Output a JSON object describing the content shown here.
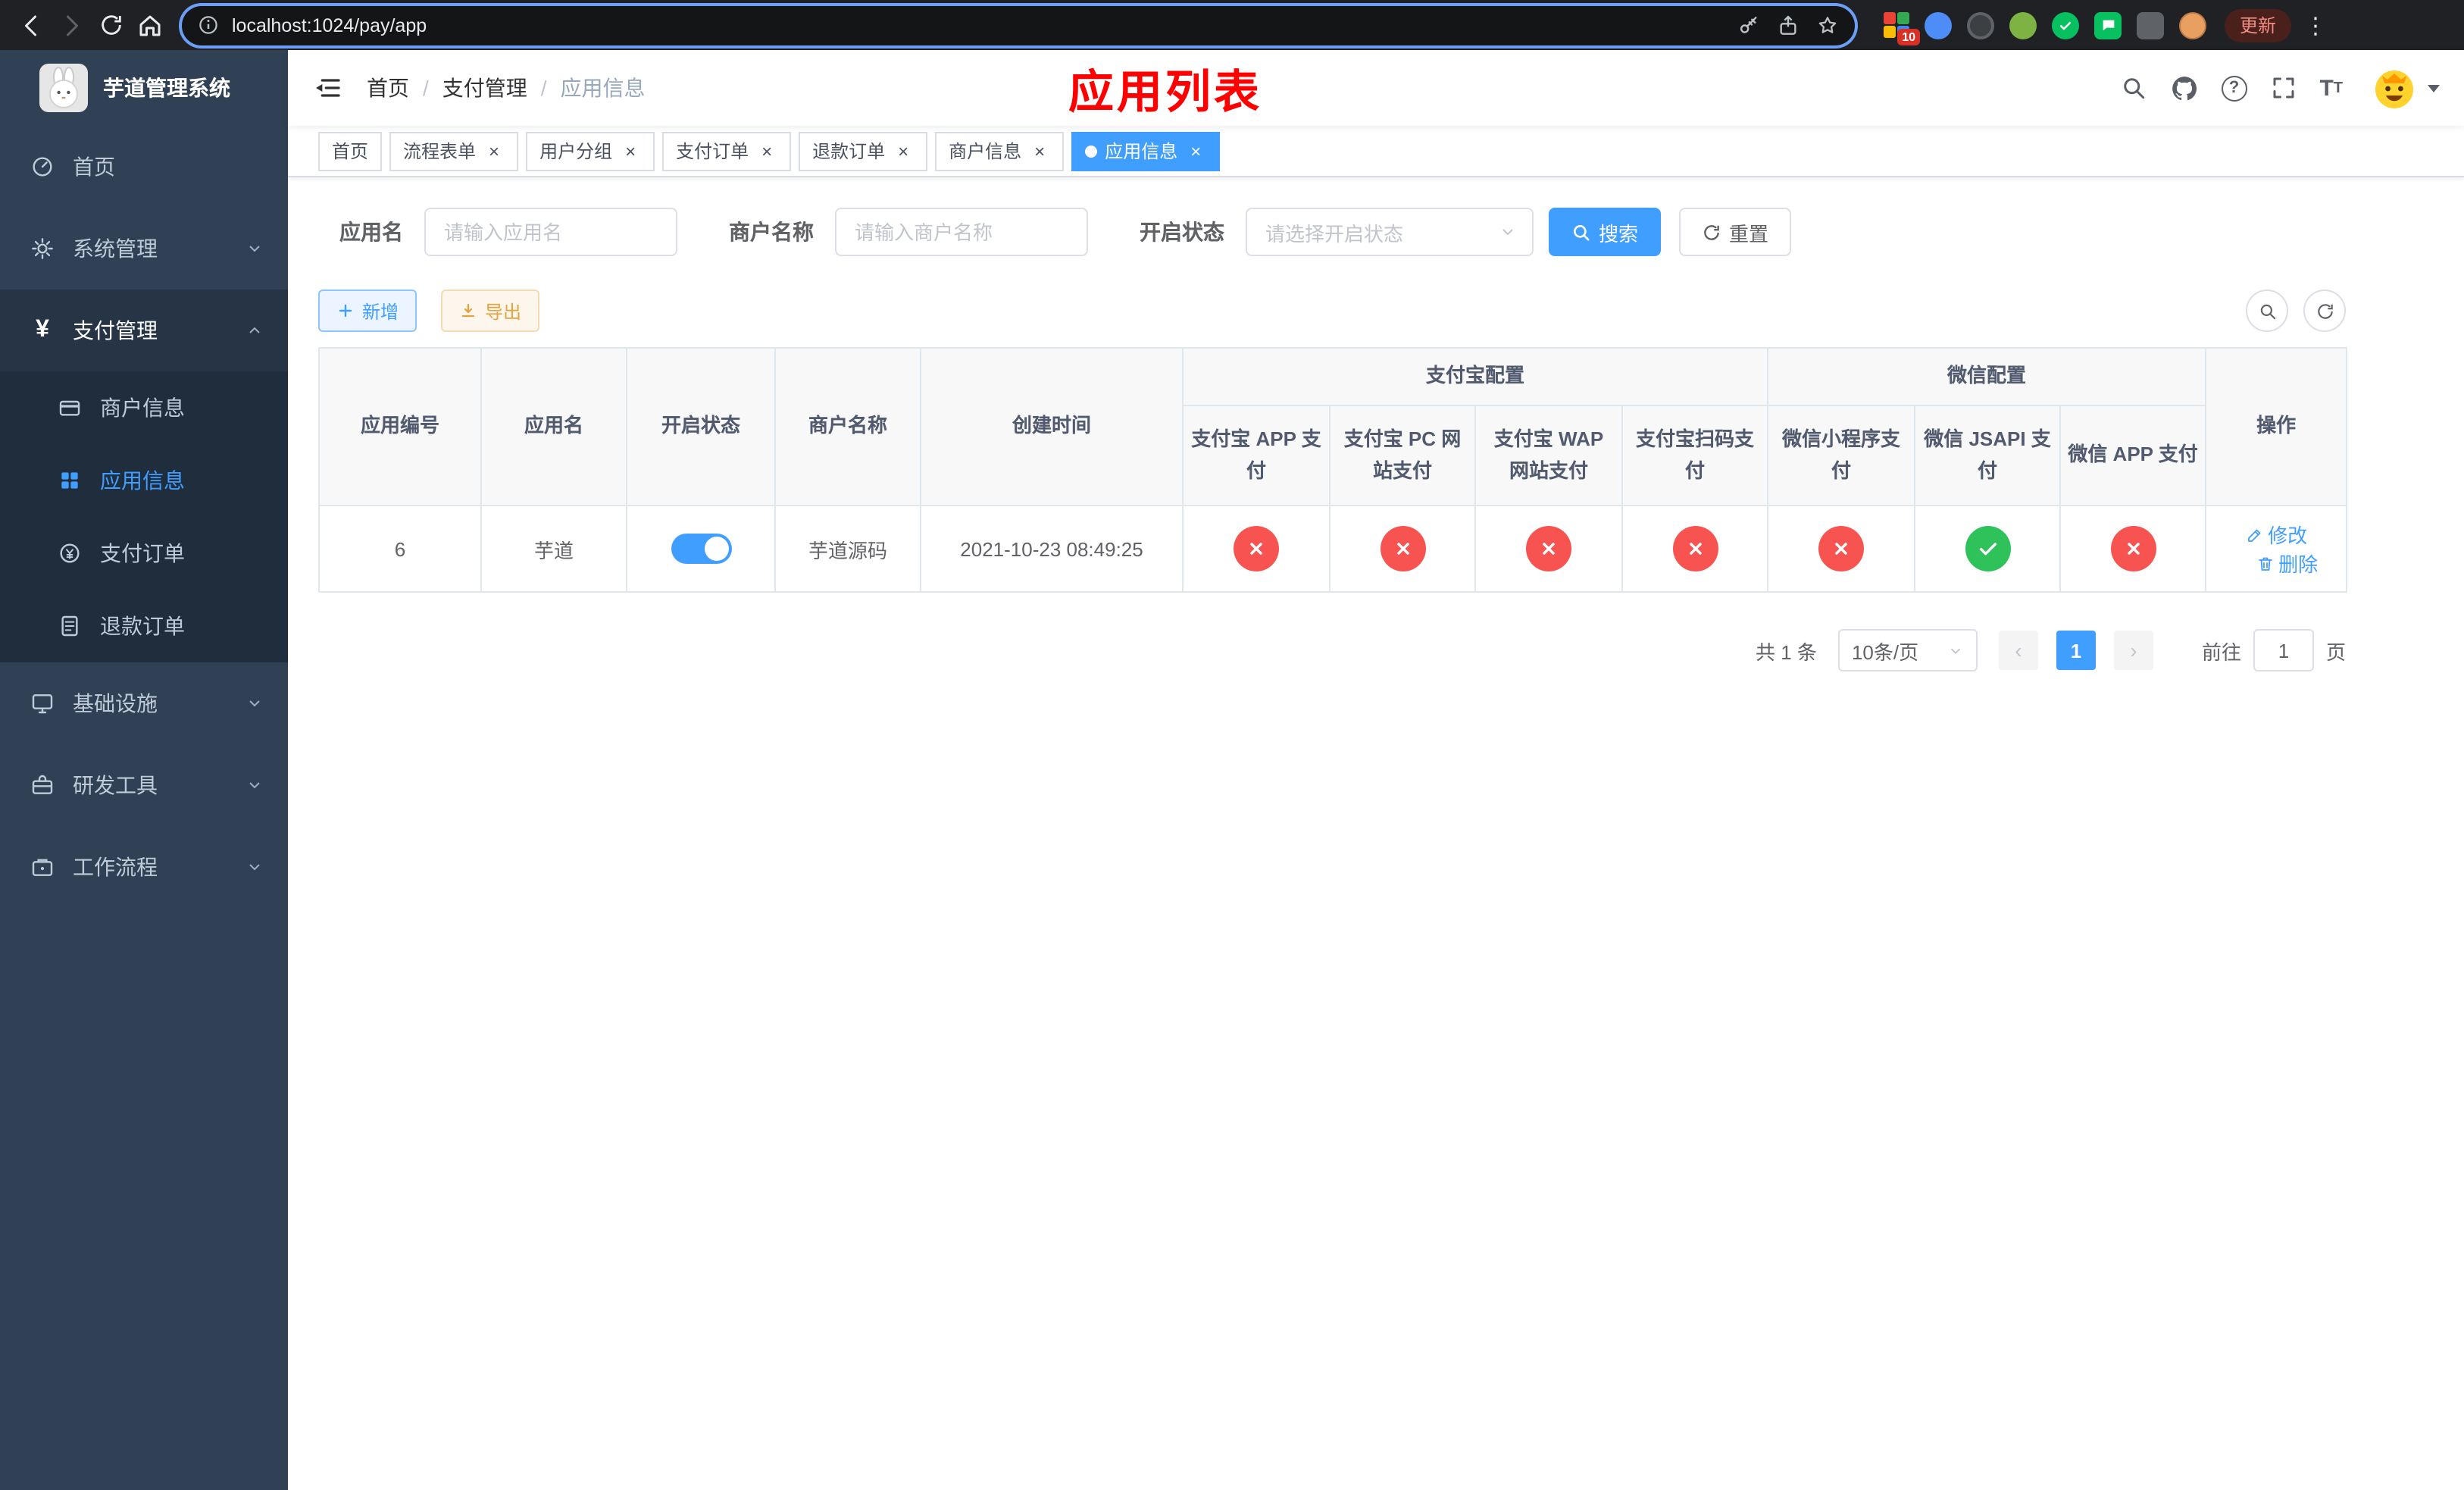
{
  "browser": {
    "url": "localhost:1024/pay/app",
    "update_button": "更新",
    "extension_badge": "10"
  },
  "sidebar": {
    "logo_title": "芋道管理系统",
    "items": [
      {
        "label": "首页"
      },
      {
        "label": "系统管理"
      },
      {
        "label": "支付管理",
        "expanded": true
      },
      {
        "label": "基础设施"
      },
      {
        "label": "研发工具"
      },
      {
        "label": "工作流程"
      }
    ],
    "payment_submenu": [
      {
        "label": "商户信息"
      },
      {
        "label": "应用信息",
        "active": true
      },
      {
        "label": "支付订单"
      },
      {
        "label": "退款订单"
      }
    ]
  },
  "navbar": {
    "breadcrumb": [
      "首页",
      "支付管理",
      "应用信息"
    ],
    "overlay_title": "应用列表"
  },
  "tabs": [
    {
      "label": "首页",
      "closable": false
    },
    {
      "label": "流程表单",
      "closable": true
    },
    {
      "label": "用户分组",
      "closable": true
    },
    {
      "label": "支付订单",
      "closable": true
    },
    {
      "label": "退款订单",
      "closable": true
    },
    {
      "label": "商户信息",
      "closable": true
    },
    {
      "label": "应用信息",
      "closable": true,
      "active": true
    }
  ],
  "filters": {
    "app_name_label": "应用名",
    "app_name_placeholder": "请输入应用名",
    "merchant_label": "商户名称",
    "merchant_placeholder": "请输入商户名称",
    "status_label": "开启状态",
    "status_placeholder": "请选择开启状态",
    "search_button": "搜索",
    "reset_button": "重置"
  },
  "toolbar": {
    "add_button": "新增",
    "export_button": "导出"
  },
  "table": {
    "headers": {
      "app_id": "应用编号",
      "app_name": "应用名",
      "status": "开启状态",
      "merchant": "商户名称",
      "create_time": "创建时间",
      "alipay_group": "支付宝配置",
      "wechat_group": "微信配置",
      "sub": [
        "支付宝 APP 支付",
        "支付宝 PC 网站支付",
        "支付宝 WAP 网站支付",
        "支付宝扫码支付",
        "微信小程序支付",
        "微信 JSAPI 支付",
        "微信 APP 支付"
      ],
      "actions": "操作"
    },
    "row": {
      "app_id": "6",
      "app_name": "芋道",
      "enabled": true,
      "merchant": "芋道源码",
      "create_time": "2021-10-23 08:49:25",
      "statuses": [
        "fail",
        "fail",
        "fail",
        "fail",
        "fail",
        "success",
        "fail"
      ],
      "edit_label": "修改",
      "delete_label": "删除"
    }
  },
  "pagination": {
    "total_text": "共 1 条",
    "page_size": "10条/页",
    "current_page": "1",
    "goto_label": "前往",
    "goto_value": "1",
    "page_unit": "页"
  },
  "colors": {
    "accent": "#409eff",
    "fail": "#f75350",
    "success": "#2fc25b",
    "title_red": "#ff0000",
    "sidebar_bg": "#304156",
    "submenu_bg": "#1f2d3d"
  }
}
